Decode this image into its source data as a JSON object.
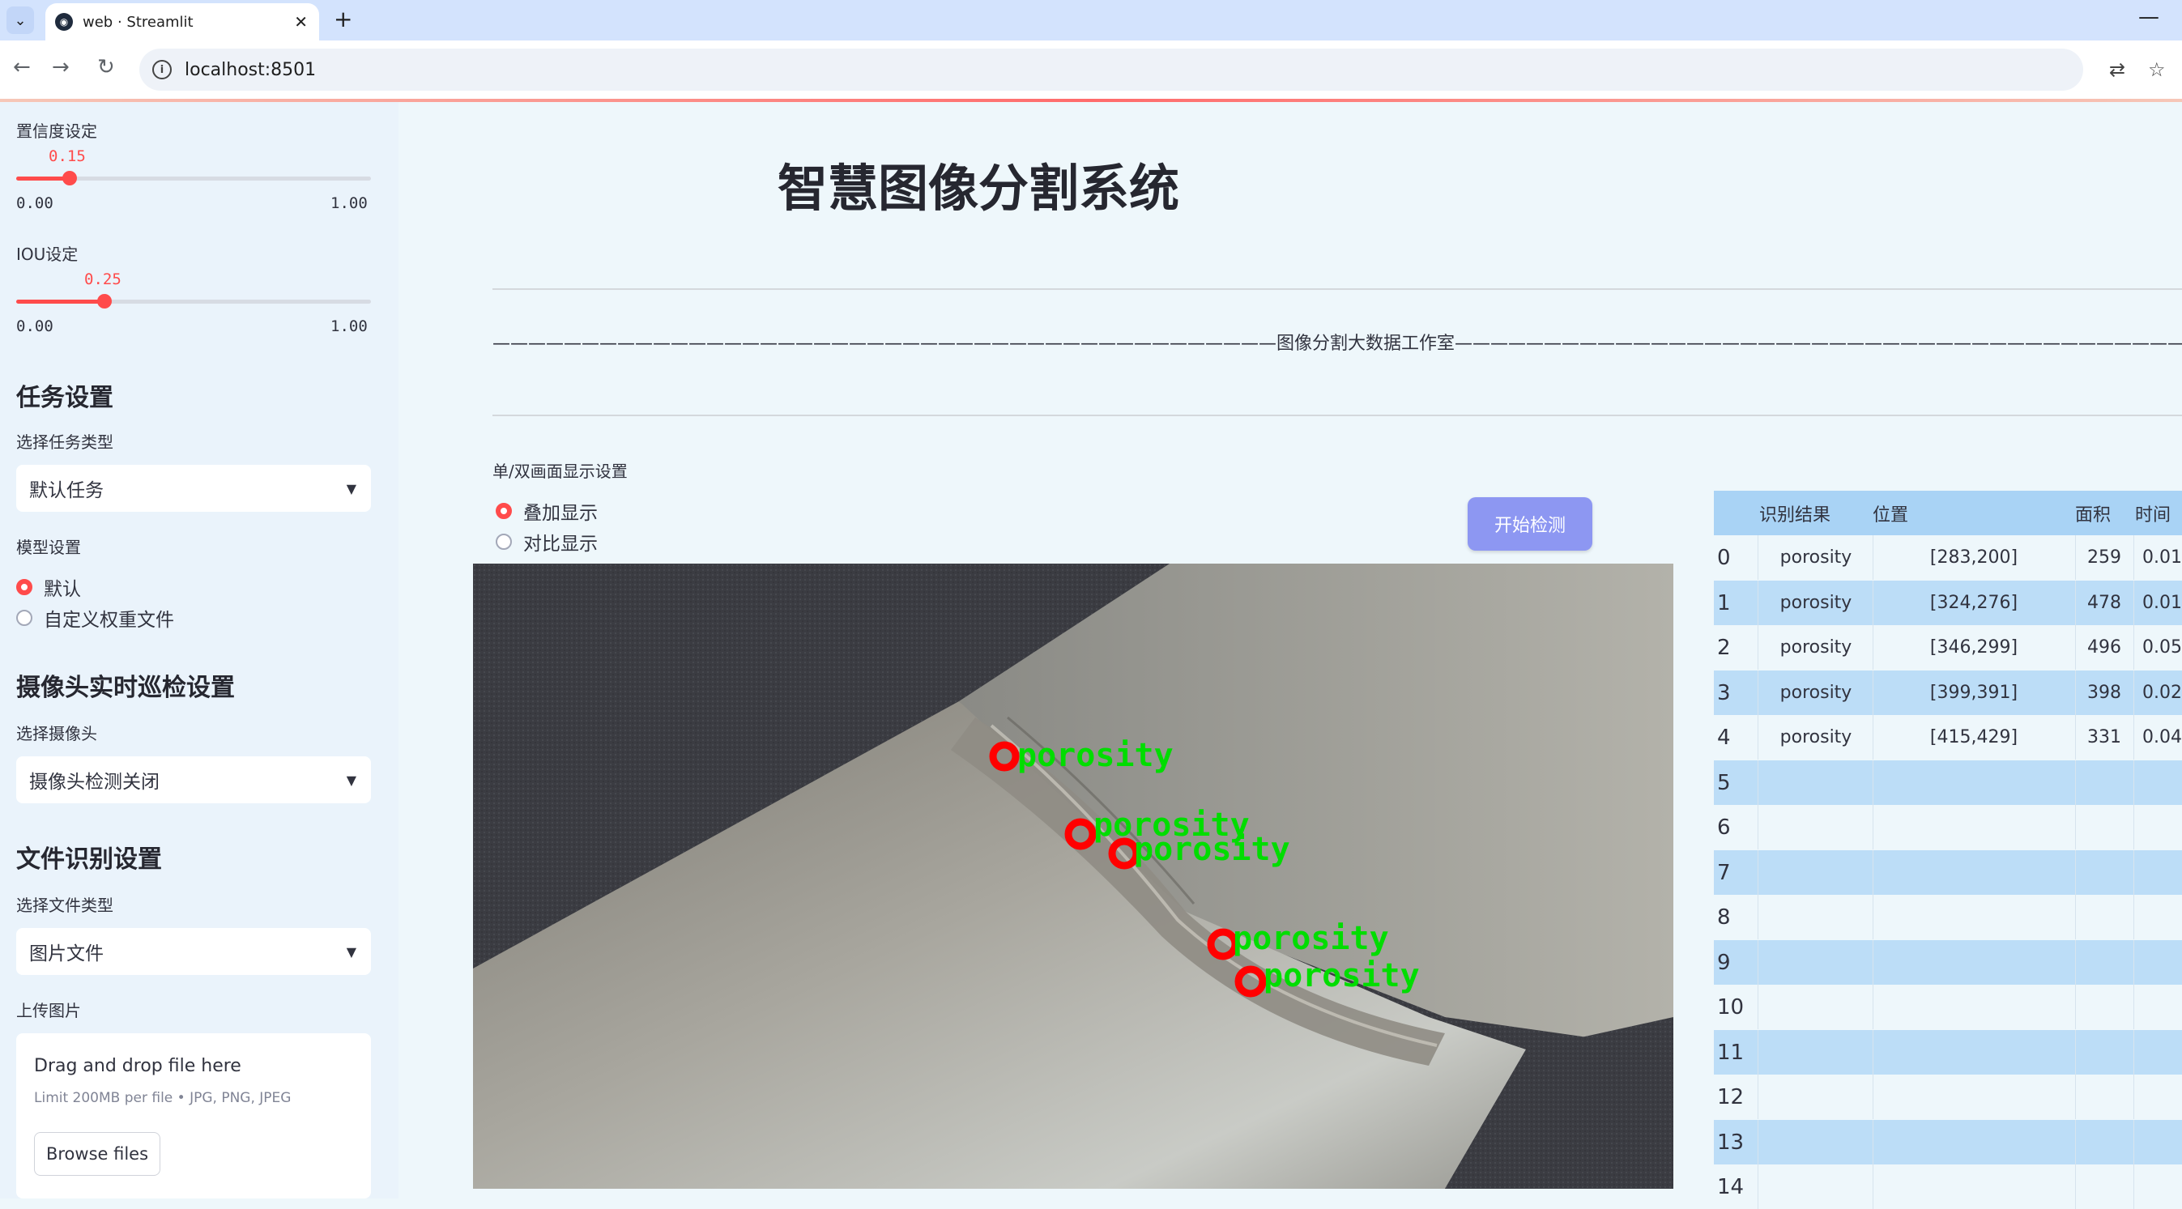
{
  "browser": {
    "tab_title": "web · Streamlit",
    "url": "localhost:8501"
  },
  "sidebar": {
    "confidence": {
      "label": "置信度设定",
      "value": "0.15",
      "value_fraction": 0.15,
      "min": "0.00",
      "max": "1.00"
    },
    "iou": {
      "label": "IOU设定",
      "value": "0.25",
      "value_fraction": 0.25,
      "min": "0.00",
      "max": "1.00"
    },
    "task_section": "任务设置",
    "task_type_label": "选择任务类型",
    "task_type_value": "默认任务",
    "model_label": "模型设置",
    "model_options": [
      "默认",
      "自定义权重文件"
    ],
    "model_selected": 0,
    "camera_section": "摄像头实时巡检设置",
    "camera_label": "选择摄像头",
    "camera_value": "摄像头检测关闭",
    "file_section": "文件识别设置",
    "file_type_label": "选择文件类型",
    "file_type_value": "图片文件",
    "upload_label": "上传图片",
    "upload_title": "Drag and drop file here",
    "upload_sub": "Limit 200MB per file • JPG, PNG, JPEG",
    "browse_label": "Browse files"
  },
  "main": {
    "title": "智慧图像分割系统",
    "divider_text": "————————————————————————————————————————————图像分割大数据工作室————————————————————————————————————————————",
    "display_label": "单/双画面显示设置",
    "display_options": [
      "叠加显示",
      "对比显示"
    ],
    "display_selected": 0,
    "start_button": "开始检测",
    "detections": [
      "porosity",
      "porosity",
      "porosity",
      "porosity",
      "porosity"
    ]
  },
  "table": {
    "headers": [
      "",
      "识别结果",
      "位置",
      "面积",
      "时间"
    ],
    "rows": [
      {
        "idx": "0",
        "result": "porosity",
        "pos": "[283,200]",
        "area": "259",
        "time": "0.01"
      },
      {
        "idx": "1",
        "result": "porosity",
        "pos": "[324,276]",
        "area": "478",
        "time": "0.01"
      },
      {
        "idx": "2",
        "result": "porosity",
        "pos": "[346,299]",
        "area": "496",
        "time": "0.05"
      },
      {
        "idx": "3",
        "result": "porosity",
        "pos": "[399,391]",
        "area": "398",
        "time": "0.02"
      },
      {
        "idx": "4",
        "result": "porosity",
        "pos": "[415,429]",
        "area": "331",
        "time": "0.04"
      },
      {
        "idx": "5",
        "result": "",
        "pos": "",
        "area": "",
        "time": ""
      },
      {
        "idx": "6",
        "result": "",
        "pos": "",
        "area": "",
        "time": ""
      },
      {
        "idx": "7",
        "result": "",
        "pos": "",
        "area": "",
        "time": ""
      },
      {
        "idx": "8",
        "result": "",
        "pos": "",
        "area": "",
        "time": ""
      },
      {
        "idx": "9",
        "result": "",
        "pos": "",
        "area": "",
        "time": ""
      },
      {
        "idx": "10",
        "result": "",
        "pos": "",
        "area": "",
        "time": ""
      },
      {
        "idx": "11",
        "result": "",
        "pos": "",
        "area": "",
        "time": ""
      },
      {
        "idx": "12",
        "result": "",
        "pos": "",
        "area": "",
        "time": ""
      },
      {
        "idx": "13",
        "result": "",
        "pos": "",
        "area": "",
        "time": ""
      },
      {
        "idx": "14",
        "result": "",
        "pos": "",
        "area": "",
        "time": ""
      }
    ]
  },
  "colors": {
    "accent": "#ff4b4b",
    "button": "#8d97f2",
    "table_header": "#a9d3f5",
    "detection_box": "#ff0000",
    "detection_text": "#00dd00"
  }
}
